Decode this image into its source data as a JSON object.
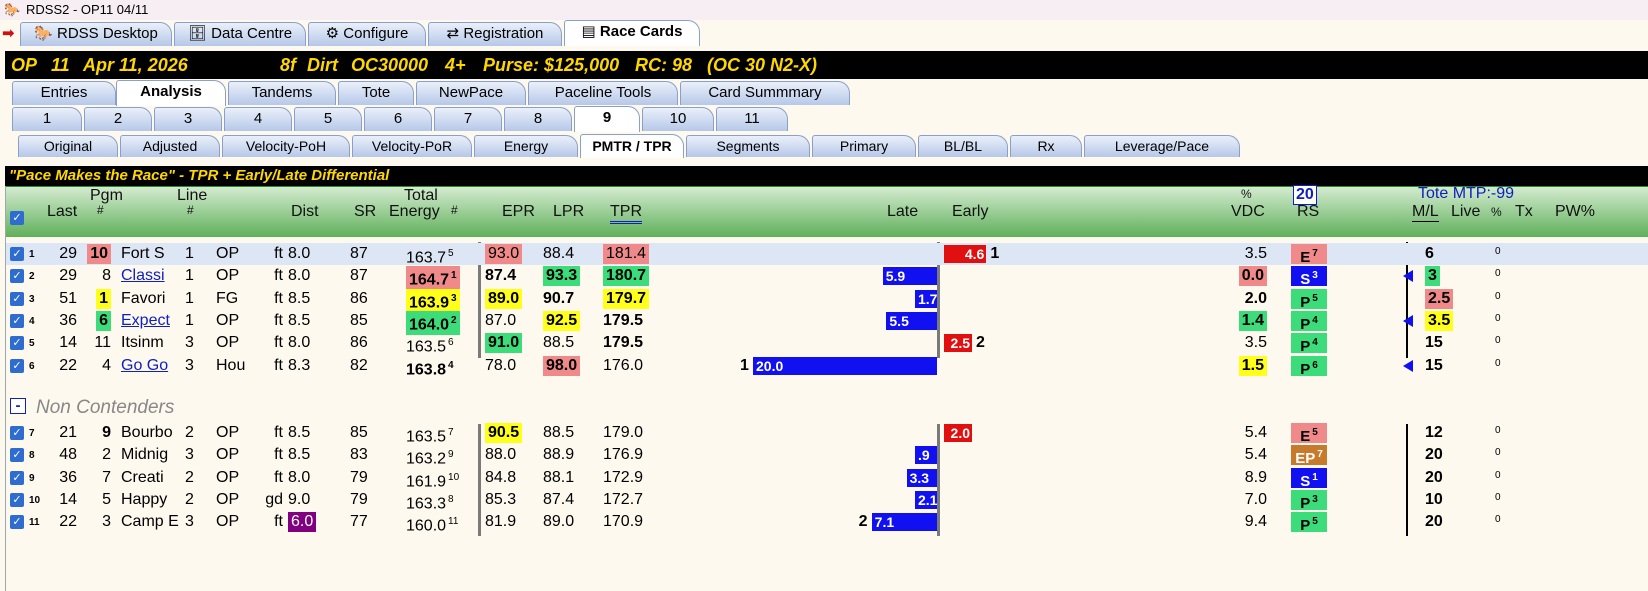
{
  "window": {
    "title": "RDSS2 - OP11  04/11"
  },
  "main_tabs": [
    "RDSS Desktop",
    "Data Centre",
    "Configure",
    "Registration",
    "Race Cards"
  ],
  "race": {
    "track": "OP",
    "race_no": "11",
    "date": "Apr 11, 2026",
    "dist": "8f",
    "surface": "Dirt",
    "class": "OC30000",
    "age": "4+",
    "purse": "Purse: $125,000",
    "rc": "RC: 98",
    "cond": "(OC 30 N2-X)"
  },
  "sub_tabs": [
    "Entries",
    "Analysis",
    "Tandems",
    "Tote",
    "NewPace",
    "Paceline Tools",
    "Card Summmary"
  ],
  "race_tabs": [
    "1",
    "2",
    "3",
    "4",
    "5",
    "6",
    "7",
    "8",
    "9",
    "10",
    "11"
  ],
  "view_tabs": [
    "Original",
    "Adjusted",
    "Velocity-PoH",
    "Velocity-PoR",
    "Energy",
    "PMTR / TPR",
    "Segments",
    "Primary",
    "BL/BL",
    "Rx",
    "Leverage/Pace"
  ],
  "pace_banner": "\"Pace Makes the Race\" - TPR + Early/Late Differential",
  "headers": {
    "last": "Last",
    "pgm": "Pgm",
    "pgm_hash": "#",
    "line": "Line",
    "line_hash": "#",
    "dist": "Dist",
    "sr": "SR",
    "total": "Total",
    "energy": "Energy",
    "energy_hash": "#",
    "epr": "EPR",
    "lpr": "LPR",
    "tpr": "TPR",
    "late": "Late",
    "early": "Early",
    "pct": "%",
    "vdc": "VDC",
    "rs_num": "20",
    "rs": "RS",
    "tote": "Tote MTP:-99",
    "ml": "M/L",
    "live": "Live",
    "pct2": "%",
    "tx": "Tx",
    "pw": "PW%"
  },
  "contenders": [
    {
      "idx": "1",
      "last": "29",
      "pgm": "10",
      "name": "Fort S",
      "line": "1",
      "trk": "OP",
      "cond": "ft",
      "dist": "8.0",
      "sr": "87",
      "energy": "163.7",
      "erank": "5",
      "epr": "93.0",
      "lpr": "88.4",
      "tpr": "181.4",
      "late": "",
      "early": "4.6",
      "early_rank": "1",
      "vdc": "3.5",
      "rs": "E",
      "rs_n": "7",
      "ml": "6",
      "live": "0"
    },
    {
      "idx": "2",
      "last": "29",
      "pgm": "8",
      "name": "Classi",
      "line": "1",
      "trk": "OP",
      "cond": "ft",
      "dist": "8.0",
      "sr": "87",
      "energy": "164.7",
      "erank": "1",
      "epr": "87.4",
      "lpr": "93.3",
      "tpr": "180.7",
      "late": "5.9",
      "early": "",
      "vdc": "0.0",
      "rs": "S",
      "rs_n": "3",
      "ml": "3",
      "live": "0"
    },
    {
      "idx": "3",
      "last": "51",
      "pgm": "1",
      "name": "Favori",
      "line": "1",
      "trk": "FG",
      "cond": "ft",
      "dist": "8.5",
      "sr": "86",
      "energy": "163.9",
      "erank": "3",
      "epr": "89.0",
      "lpr": "90.7",
      "tpr": "179.7",
      "late": "1.7",
      "early": "",
      "vdc": "2.0",
      "rs": "P",
      "rs_n": "5",
      "ml": "2.5",
      "live": "0"
    },
    {
      "idx": "4",
      "last": "36",
      "pgm": "6",
      "name": "Expect",
      "line": "1",
      "trk": "OP",
      "cond": "ft",
      "dist": "8.5",
      "sr": "85",
      "energy": "164.0",
      "erank": "2",
      "epr": "87.0",
      "lpr": "92.5",
      "tpr": "179.5",
      "late": "5.5",
      "early": "",
      "vdc": "1.4",
      "rs": "P",
      "rs_n": "4",
      "ml": "3.5",
      "live": "0"
    },
    {
      "idx": "5",
      "last": "14",
      "pgm": "11",
      "name": "Itsinm",
      "line": "3",
      "trk": "OP",
      "cond": "ft",
      "dist": "8.0",
      "sr": "86",
      "energy": "163.5",
      "erank": "6",
      "epr": "91.0",
      "lpr": "88.5",
      "tpr": "179.5",
      "late": "",
      "early": "2.5",
      "early_rank": "2",
      "vdc": "3.5",
      "rs": "P",
      "rs_n": "4",
      "ml": "15",
      "live": "0"
    },
    {
      "idx": "6",
      "last": "22",
      "pgm": "4",
      "name": "Go Go",
      "line": "3",
      "trk": "Hou",
      "cond": "ft",
      "dist": "8.3",
      "sr": "82",
      "energy": "163.8",
      "erank": "4",
      "epr": "78.0",
      "lpr": "98.0",
      "tpr": "176.0",
      "late": "20.0",
      "late_rank": "1",
      "early": "",
      "vdc": "1.5",
      "rs": "P",
      "rs_n": "6",
      "ml": "15",
      "live": "0"
    }
  ],
  "non_contenders_label": "Non Contenders",
  "non_contenders": [
    {
      "idx": "7",
      "last": "21",
      "pgm": "9",
      "name": "Bourbo",
      "line": "2",
      "trk": "OP",
      "cond": "ft",
      "dist": "8.5",
      "sr": "85",
      "energy": "163.5",
      "erank": "7",
      "epr": "90.5",
      "lpr": "88.5",
      "tpr": "179.0",
      "late": "",
      "early": "2.0",
      "vdc": "5.4",
      "rs": "E",
      "rs_n": "5",
      "ml": "12",
      "live": "0"
    },
    {
      "idx": "8",
      "last": "48",
      "pgm": "2",
      "name": "Midnig",
      "line": "3",
      "trk": "OP",
      "cond": "ft",
      "dist": "8.5",
      "sr": "83",
      "energy": "163.2",
      "erank": "9",
      "epr": "88.0",
      "lpr": "88.9",
      "tpr": "176.9",
      "late": ".9",
      "early": "",
      "vdc": "5.4",
      "rs": "EP",
      "rs_n": "7",
      "ml": "20",
      "live": "0"
    },
    {
      "idx": "9",
      "last": "36",
      "pgm": "7",
      "name": "Creati",
      "line": "2",
      "trk": "OP",
      "cond": "ft",
      "dist": "8.0",
      "sr": "79",
      "energy": "161.9",
      "erank": "10",
      "epr": "84.8",
      "lpr": "88.1",
      "tpr": "172.9",
      "late": "3.3",
      "early": "",
      "vdc": "8.9",
      "rs": "S",
      "rs_n": "1",
      "ml": "20",
      "live": "0"
    },
    {
      "idx": "10",
      "last": "14",
      "pgm": "5",
      "name": "Happy",
      "line": "2",
      "trk": "OP",
      "cond": "gd",
      "dist": "9.0",
      "sr": "79",
      "energy": "163.3",
      "erank": "8",
      "epr": "85.3",
      "lpr": "87.4",
      "tpr": "172.7",
      "late": "2.1",
      "early": "",
      "vdc": "7.0",
      "rs": "P",
      "rs_n": "3",
      "ml": "10",
      "live": "0"
    },
    {
      "idx": "11",
      "last": "22",
      "pgm": "3",
      "name": "Camp E",
      "line": "3",
      "trk": "OP",
      "cond": "ft",
      "dist": "6.0",
      "sr": "77",
      "energy": "160.0",
      "erank": "11",
      "epr": "81.9",
      "lpr": "89.0",
      "tpr": "170.9",
      "late": "7.1",
      "late_rank": "2",
      "early": "",
      "vdc": "9.4",
      "rs": "P",
      "rs_n": "5",
      "ml": "20",
      "live": "0"
    }
  ],
  "colors": {
    "red": "#f08a8a",
    "green": "#3ddc7a",
    "yellow": "#ffff1a",
    "blue": "#1010f0",
    "orange": "#c77a2b",
    "purple": "#800080"
  }
}
